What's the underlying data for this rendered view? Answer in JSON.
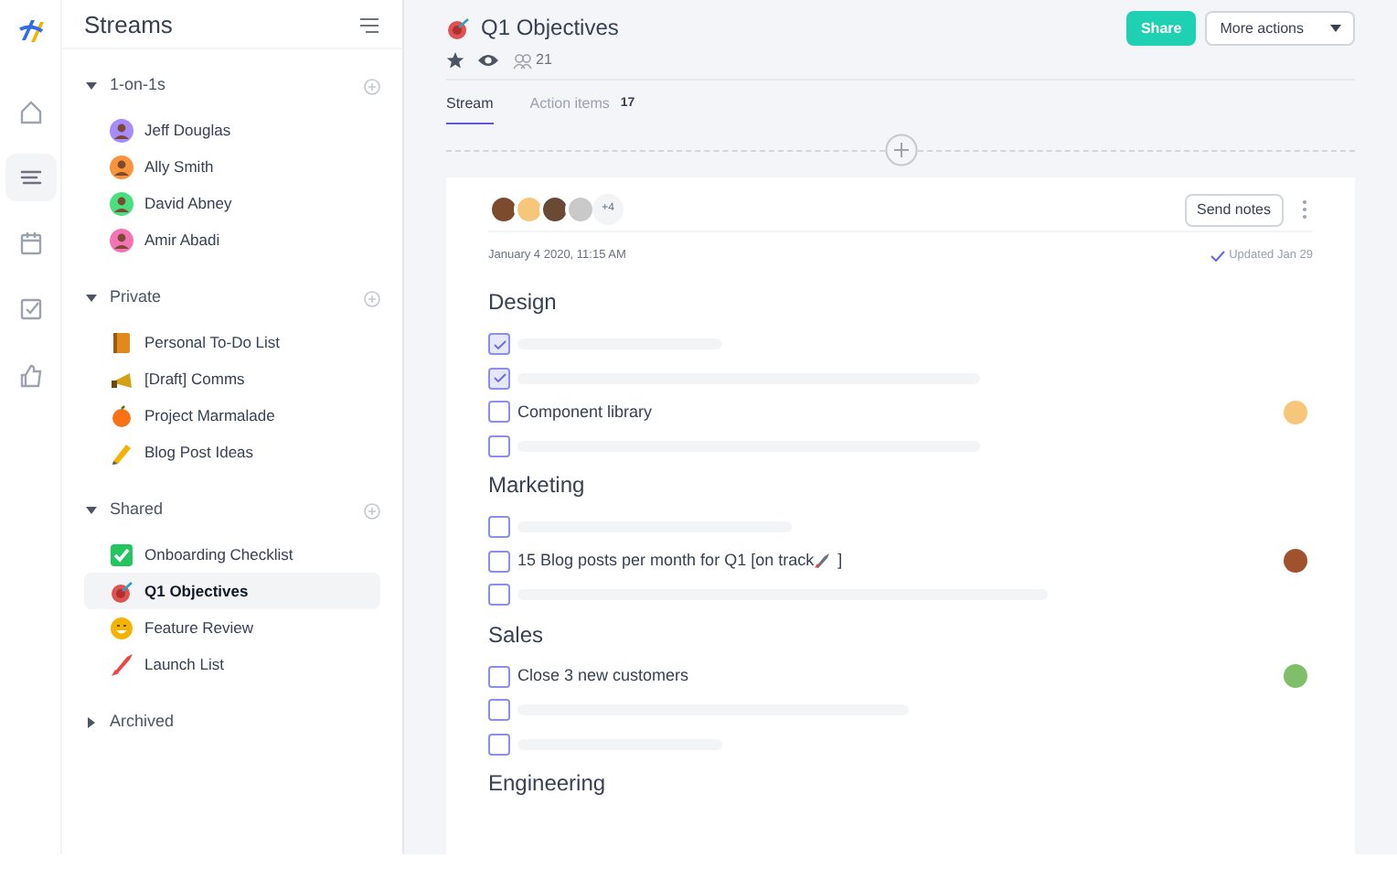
{
  "rail": [
    {
      "kind": "home",
      "selected": false
    },
    {
      "kind": "streams",
      "selected": true
    },
    {
      "kind": "calendar",
      "selected": false
    },
    {
      "kind": "tasks",
      "selected": false
    },
    {
      "kind": "like",
      "selected": false
    }
  ],
  "sidebar": {
    "title": "Streams",
    "groups": [
      {
        "label": "1-on-1s",
        "expanded": true,
        "items": [
          {
            "label": "Jeff Douglas",
            "kind": "avatar",
            "color": "#a78bfa",
            "selected": false
          },
          {
            "label": "Ally Smith",
            "kind": "avatar",
            "color": "#fb923c",
            "selected": false
          },
          {
            "label": "David Abney",
            "kind": "avatar",
            "color": "#4ade80",
            "selected": false
          },
          {
            "label": "Amir Abadi",
            "kind": "avatar",
            "color": "#f472b6",
            "selected": false
          }
        ]
      },
      {
        "label": "Private",
        "expanded": true,
        "items": [
          {
            "label": "Personal To-Do List",
            "kind": "book",
            "color": "#e08a1e",
            "selected": false
          },
          {
            "label": "[Draft] Comms",
            "kind": "megaphone",
            "color": "#d4a017",
            "selected": false
          },
          {
            "label": "Project Marmalade",
            "kind": "fruit",
            "color": "#f97316",
            "selected": false
          },
          {
            "label": "Blog Post Ideas",
            "kind": "pencil",
            "color": "#f5b301",
            "selected": false
          }
        ]
      },
      {
        "label": "Shared",
        "expanded": true,
        "items": [
          {
            "label": "Onboarding Checklist",
            "kind": "check",
            "color": "#22c55e",
            "selected": false
          },
          {
            "label": "Q1 Objectives",
            "kind": "target",
            "color": "#e05252",
            "selected": true
          },
          {
            "label": "Feature Review",
            "kind": "face",
            "color": "#f5b301",
            "selected": false
          },
          {
            "label": "Launch List",
            "kind": "rocket",
            "color": "#ef4444",
            "selected": false
          }
        ]
      },
      {
        "label": "Archived",
        "expanded": false
      }
    ]
  },
  "header": {
    "title": "Q1 Objectives",
    "starred": true,
    "count": "21",
    "share": "Share",
    "more": "More actions"
  },
  "tabs": [
    {
      "label": "Stream",
      "selected": true
    },
    {
      "label": "Action items",
      "count": "17",
      "selected": false
    }
  ],
  "card": {
    "attendees": [
      {
        "color": "#7c4a2d"
      },
      {
        "color": "#f6c77a"
      },
      {
        "color": "#6b4a35"
      },
      {
        "color": "#c9c9c9"
      }
    ],
    "more": "+4",
    "send": "Send notes",
    "date": "January 4 2020, 11:15 AM",
    "updated": "Updated Jan 29",
    "sections": [
      {
        "title": "Design",
        "items": [
          {
            "kind": "skeleton",
            "checked": true
          },
          {
            "kind": "skeleton",
            "checked": true
          },
          {
            "kind": "text",
            "text": "Component library",
            "checked": false,
            "assignee": {
              "color": "#f6c77a"
            }
          },
          {
            "kind": "skeleton",
            "checked": false
          }
        ]
      },
      {
        "title": "Marketing",
        "items": [
          {
            "kind": "skeleton",
            "checked": false
          },
          {
            "kind": "text",
            "text": "15 Blog posts per month for Q1 [on track",
            "text_after": "]",
            "checked": false,
            "assignee": {
              "color": "#a0522d"
            }
          },
          {
            "kind": "skeleton",
            "checked": false
          }
        ]
      },
      {
        "title": "Sales",
        "items": [
          {
            "kind": "text",
            "text": "Close 3 new customers",
            "checked": false,
            "assignee": {
              "color": "#7fbf6a"
            }
          },
          {
            "kind": "skeleton",
            "checked": false
          },
          {
            "kind": "skeleton",
            "checked": false
          }
        ]
      },
      {
        "title": "Engineering"
      }
    ]
  }
}
